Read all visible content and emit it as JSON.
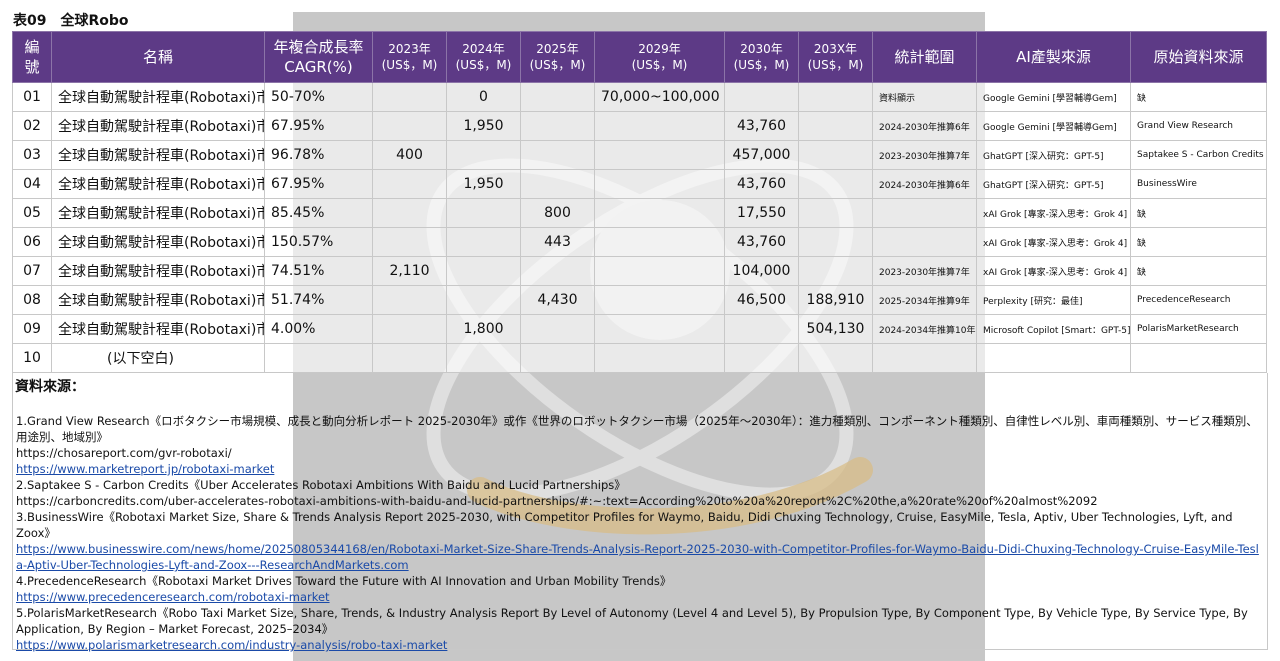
{
  "title": "表09　全球Robo",
  "headers": {
    "no": [
      "編",
      "號"
    ],
    "name": "名稱",
    "cagr": [
      "年複合成長率",
      "CAGR(%)"
    ],
    "y2023": [
      "2023年",
      "(US$，M)"
    ],
    "y2024": [
      "2024年",
      "(US$，M)"
    ],
    "y2025": [
      "2025年",
      "(US$，M)"
    ],
    "y2029": [
      "2029年",
      "(US$，M)"
    ],
    "y2030": [
      "2030年",
      "(US$，M)"
    ],
    "y203x": [
      "203X年",
      "(US$，M)"
    ],
    "scope": "統計範圍",
    "ai": "AI產製來源",
    "origin": "原始資料來源"
  },
  "rows": [
    {
      "no": "01",
      "name": "全球自動駕駛計程車(Robotaxi)市場",
      "cagr": "50-70%",
      "y2023": "",
      "y2024": "0",
      "y2025": "",
      "y2029": "70,000~100,000",
      "y2030": "",
      "y203x": "",
      "scope": "資料顯示",
      "ai": "Google Gemini [學習輔導Gem]",
      "origin": "缺"
    },
    {
      "no": "02",
      "name": "全球自動駕駛計程車(Robotaxi)市場",
      "cagr": "67.95%",
      "y2023": "",
      "y2024": "1,950",
      "y2025": "",
      "y2029": "",
      "y2030": "43,760",
      "y203x": "",
      "scope": "2024-2030年推算6年",
      "ai": "Google Gemini [學習輔導Gem]",
      "origin": "Grand View Research"
    },
    {
      "no": "03",
      "name": "全球自動駕駛計程車(Robotaxi)市場",
      "cagr": "96.78%",
      "y2023": "400",
      "y2024": "",
      "y2025": "",
      "y2029": "",
      "y2030": "457,000",
      "y203x": "",
      "scope": "2023-2030年推算7年",
      "ai": "GhatGPT [深入研究：GPT-5]",
      "origin": "Saptakee S - Carbon Credits"
    },
    {
      "no": "04",
      "name": "全球自動駕駛計程車(Robotaxi)市場",
      "cagr": "67.95%",
      "y2023": "",
      "y2024": "1,950",
      "y2025": "",
      "y2029": "",
      "y2030": "43,760",
      "y203x": "",
      "scope": "2024-2030年推算6年",
      "ai": "GhatGPT [深入研究：GPT-5]",
      "origin": "BusinessWire"
    },
    {
      "no": "05",
      "name": "全球自動駕駛計程車(Robotaxi)市場",
      "cagr": "85.45%",
      "y2023": "",
      "y2024": "",
      "y2025": "800",
      "y2029": "",
      "y2030": "17,550",
      "y203x": "",
      "scope": "",
      "ai": "xAI Grok [專家-深入思考：Grok 4]",
      "origin": "缺"
    },
    {
      "no": "06",
      "name": "全球自動駕駛計程車(Robotaxi)市場",
      "cagr": "150.57%",
      "y2023": "",
      "y2024": "",
      "y2025": "443",
      "y2029": "",
      "y2030": "43,760",
      "y203x": "",
      "scope": "",
      "ai": "xAI Grok [專家-深入思考：Grok 4]",
      "origin": "缺"
    },
    {
      "no": "07",
      "name": "全球自動駕駛計程車(Robotaxi)市場",
      "cagr": "74.51%",
      "y2023": "2,110",
      "y2024": "",
      "y2025": "",
      "y2029": "",
      "y2030": "104,000",
      "y203x": "",
      "scope": "2023-2030年推算7年",
      "ai": "xAI Grok [專家-深入思考：Grok 4]",
      "origin": "缺"
    },
    {
      "no": "08",
      "name": "全球自動駕駛計程車(Robotaxi)市場",
      "cagr": "51.74%",
      "y2023": "",
      "y2024": "",
      "y2025": "4,430",
      "y2029": "",
      "y2030": "46,500",
      "y203x": "188,910",
      "scope": "2025-2034年推算9年",
      "ai": "Perplexity [研究：最佳]",
      "origin": "PrecedenceResearch"
    },
    {
      "no": "09",
      "name": "全球自動駕駛計程車(Robotaxi)市場",
      "cagr": "4.00%",
      "y2023": "",
      "y2024": "1,800",
      "y2025": "",
      "y2029": "",
      "y2030": "",
      "y203x": "504,130",
      "scope": "2024-2034年推算10年",
      "ai": "Microsoft Copilot [Smart：GPT-5]",
      "origin": "PolarisMarketResearch"
    },
    {
      "no": "10",
      "name": "(以下空白)",
      "cagr": "",
      "y2023": "",
      "y2024": "",
      "y2025": "",
      "y2029": "",
      "y2030": "",
      "y203x": "",
      "scope": "",
      "ai": "",
      "origin": ""
    }
  ],
  "sources": {
    "title": "資料來源：",
    "s1_text": "1.Grand View Research《ロボタクシー市場規模、成長と動向分析レポート 2025-2030年》或作《世界のロボットタクシー市場（2025年～2030年）：進力種類別、コンポーネント種類別、自律性レベル別、車両種類別、サービス種類別、用途別、地域別》",
    "s1_url1": "https://chosareport.com/gvr-robotaxi/",
    "s1_url2": "https://www.marketreport.jp/robotaxi-market",
    "s2_text": "2.Saptakee S - Carbon Credits《Uber Accelerates Robotaxi Ambitions With Baidu and Lucid Partnerships》",
    "s2_url": "https://carboncredits.com/uber-accelerates-robotaxi-ambitions-with-baidu-and-lucid-partnerships/#:~:text=According%20to%20a%20report%2C%20the,a%20rate%20of%20almost%2092",
    "s3_text": "3.BusinessWire《Robotaxi Market Size, Share & Trends Analysis Report 2025-2030, with Competitor Profiles for Waymo, Baidu, Didi Chuxing Technology, Cruise, EasyMile, Tesla, Aptiv, Uber Technologies, Lyft, and Zoox》",
    "s3_url": "https://www.businesswire.com/news/home/20250805344168/en/Robotaxi-Market-Size-Share-Trends-Analysis-Report-2025-2030-with-Competitor-Profiles-for-Waymo-Baidu-Didi-Chuxing-Technology-Cruise-EasyMile-Tesla-Aptiv-Uber-Technologies-Lyft-and-Zoox---ResearchAndMarkets.com",
    "s4_text": "4.PrecedenceResearch《Robotaxi Market Drives Toward the Future with AI Innovation and Urban Mobility Trends》",
    "s4_url": "https://www.precedenceresearch.com/robotaxi-market",
    "s5_text": "5.PolarisMarketResearch《Robo Taxi Market Size, Share, Trends, & Industry Analysis Report By Level of Autonomy (Level 4 and Level 5), By Propulsion Type, By Component Type, By Vehicle Type, By Service Type, By Application, By Region – Market Forecast, 2025–2034》",
    "s5_url": "https://www.polarismarketresearch.com/industry-analysis/robo-taxi-market"
  },
  "colors": {
    "header_bg": "#5d3a86",
    "watermark_bg": "#c7c7c7",
    "link": "#1a4aa8"
  }
}
